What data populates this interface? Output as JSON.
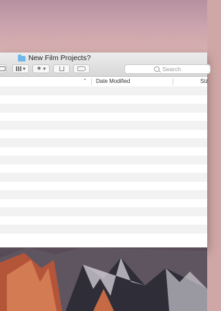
{
  "window": {
    "title": "New Film Projects?"
  },
  "toolbar": {
    "search_placeholder": "Search",
    "buttons": [
      {
        "icon": "view-icon"
      },
      {
        "icon": "grid-view-icon"
      },
      {
        "icon": "gear-icon"
      },
      {
        "icon": "share-icon"
      },
      {
        "icon": "tag-icon"
      }
    ]
  },
  "list": {
    "columns": [
      {
        "label": ""
      },
      {
        "label": "Date Modified"
      },
      {
        "label": "Siz"
      }
    ],
    "row_count": 18
  },
  "colors": {
    "folder": "#6fb6ea",
    "row_alt": "#f2f2f2"
  }
}
